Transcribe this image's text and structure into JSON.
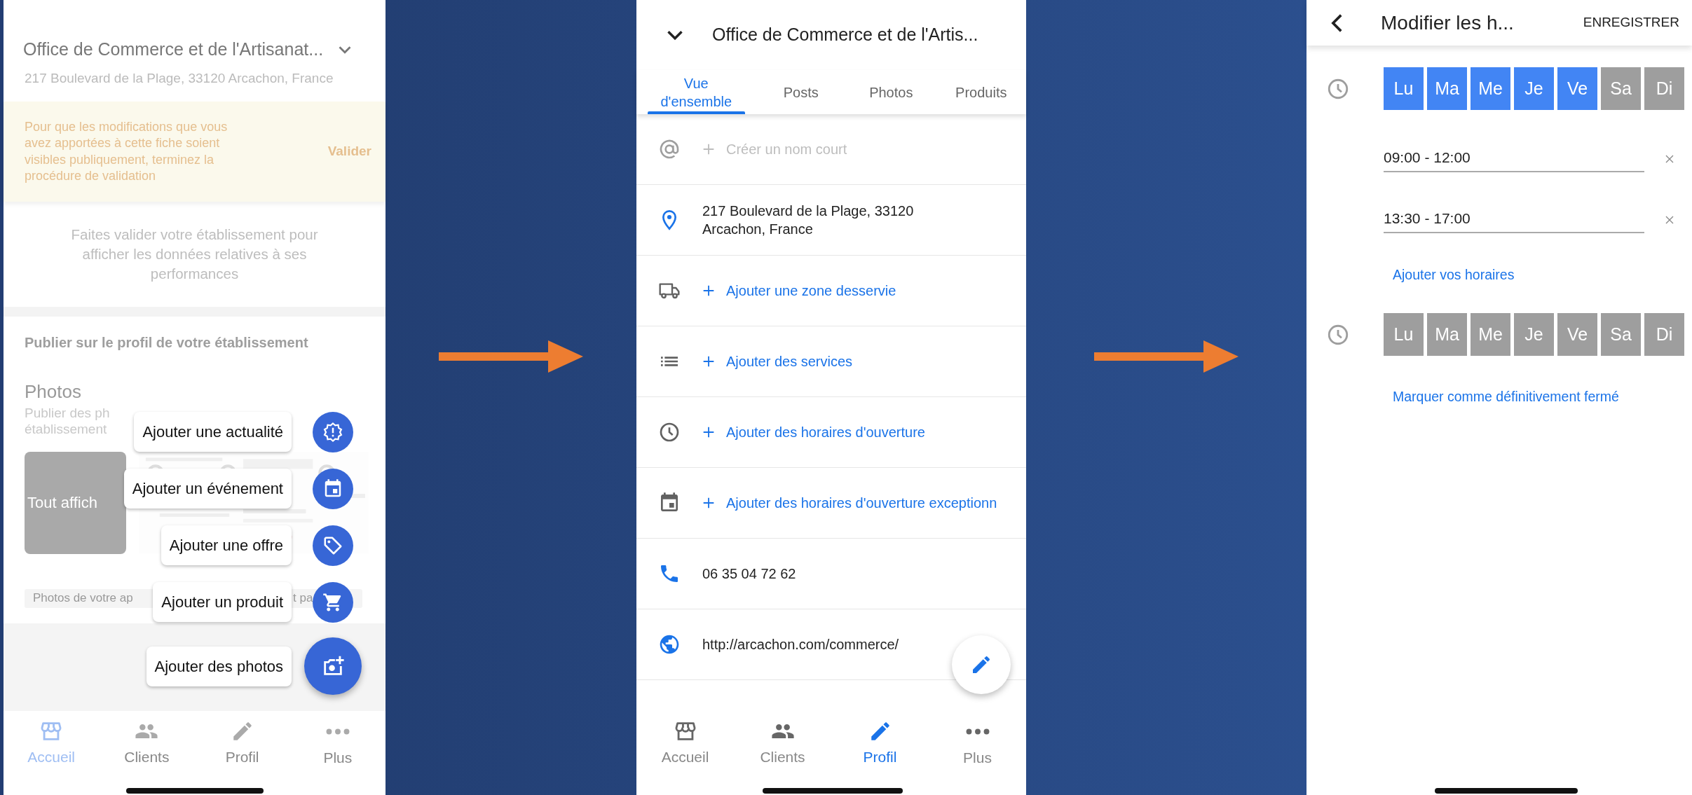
{
  "left_screen": {
    "header": {
      "title": "Office de Commerce et de l'Artisanat...",
      "address": "217 Boulevard de la Plage, 33120 Arcachon, France"
    },
    "banner": {
      "message": "Pour que les modifications que vous avez apportées à cette fiche soient visibles publiquement, terminez la procédure de validation",
      "action": "Valider"
    },
    "performance_note": "Faites valider votre établissement pour afficher les données relatives à ses performances",
    "publish": {
      "title": "Publier sur le profil de votre établissement",
      "photos_title": "Photos",
      "description_lines": [
        "Publier des ph",
        "établissement"
      ],
      "show_all": "Tout affich",
      "caption_parts": [
        "Photos de votre ap",
        "t pa"
      ]
    },
    "fab_menu": [
      {
        "label": "Ajouter une actualité",
        "kind": "mini"
      },
      {
        "label": "Ajouter un événement",
        "kind": "mini"
      },
      {
        "label": "Ajouter une offre",
        "kind": "mini"
      },
      {
        "label": "Ajouter un produit",
        "kind": "mini"
      },
      {
        "label": "Ajouter des photos",
        "kind": "main"
      }
    ],
    "bottom_nav": [
      {
        "label": "Accueil",
        "selected": true
      },
      {
        "label": "Clients",
        "selected": false
      },
      {
        "label": "Profil",
        "selected": false
      },
      {
        "label": "Plus",
        "selected": false
      }
    ]
  },
  "middle_screen": {
    "title": "Office de Commerce et de l'Artis...",
    "tabs": [
      {
        "label": "Vue d'ensemble",
        "selected": true
      },
      {
        "label": "Posts",
        "selected": false
      },
      {
        "label": "Photos",
        "selected": false
      },
      {
        "label": "Produits",
        "selected": false
      }
    ],
    "rows": [
      {
        "text": "Créer un nom court",
        "kind": "muted"
      },
      {
        "text": "217 Boulevard de la Plage, 33120 Arcachon, France",
        "kind": "value"
      },
      {
        "text": "Ajouter une zone desservie",
        "kind": "add"
      },
      {
        "text": "Ajouter des services",
        "kind": "add"
      },
      {
        "text": "Ajouter des horaires d'ouverture",
        "kind": "add"
      },
      {
        "text": "Ajouter des horaires d'ouverture exceptionn",
        "kind": "add"
      },
      {
        "text": "06 35 04 72 62",
        "kind": "value"
      },
      {
        "text": "http://arcachon.com/commerce/",
        "kind": "value"
      }
    ],
    "bottom_nav": [
      {
        "label": "Accueil",
        "selected": false
      },
      {
        "label": "Clients",
        "selected": false
      },
      {
        "label": "Profil",
        "selected": true
      },
      {
        "label": "Plus",
        "selected": false
      }
    ]
  },
  "right_screen": {
    "title": "Modifier les h...",
    "save": "ENREGISTRER",
    "groups": [
      {
        "days": [
          {
            "label": "Lu",
            "selected": true
          },
          {
            "label": "Ma",
            "selected": true
          },
          {
            "label": "Me",
            "selected": true
          },
          {
            "label": "Je",
            "selected": true
          },
          {
            "label": "Ve",
            "selected": true
          },
          {
            "label": "Sa",
            "selected": false
          },
          {
            "label": "Di",
            "selected": false
          }
        ],
        "hours": [
          "09:00 - 12:00",
          "13:30 - 17:00"
        ],
        "add_link": "Ajouter vos horaires"
      },
      {
        "days": [
          {
            "label": "Lu",
            "selected": false
          },
          {
            "label": "Ma",
            "selected": false
          },
          {
            "label": "Me",
            "selected": false
          },
          {
            "label": "Je",
            "selected": false
          },
          {
            "label": "Ve",
            "selected": false
          },
          {
            "label": "Sa",
            "selected": false
          },
          {
            "label": "Di",
            "selected": false
          }
        ]
      }
    ],
    "close_link": "Marquer comme définitivement fermé"
  }
}
